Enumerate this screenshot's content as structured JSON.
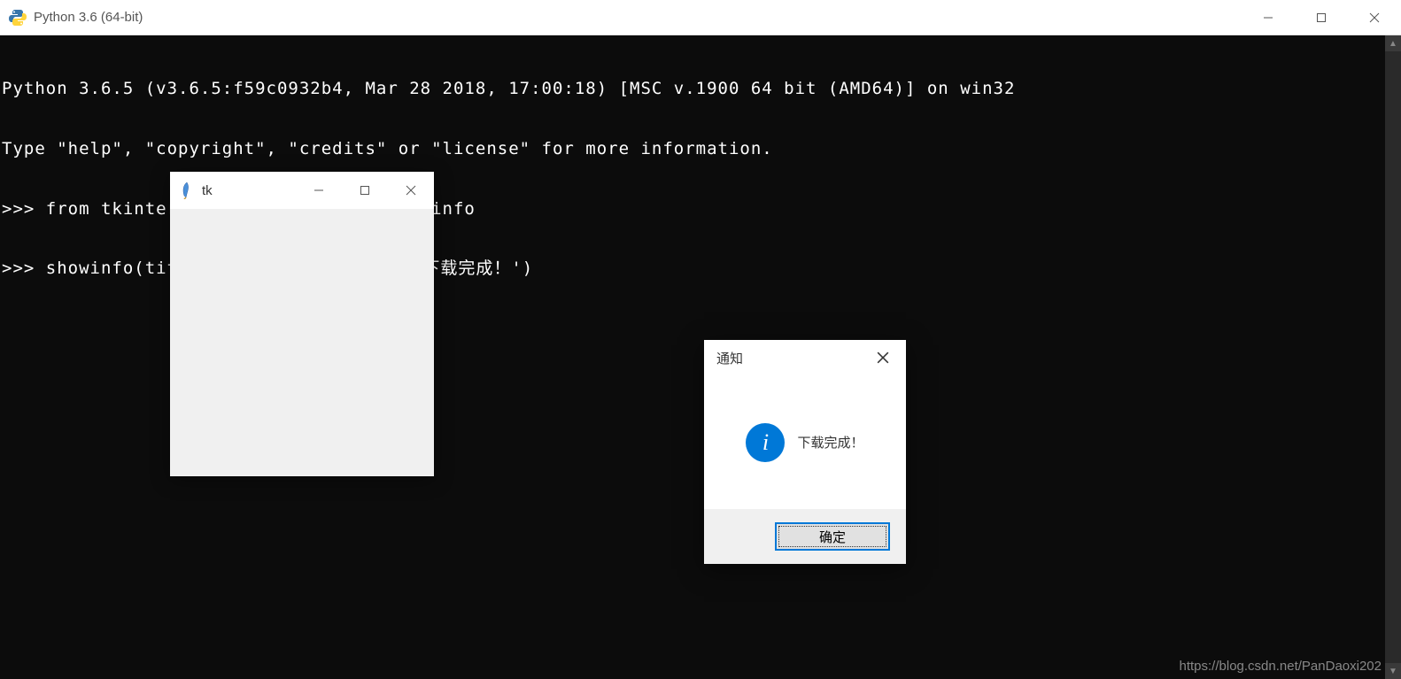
{
  "main_window": {
    "title": "Python 3.6 (64-bit)",
    "icon_name": "python-icon"
  },
  "console": {
    "line1": "Python 3.6.5 (v3.6.5:f59c0932b4, Mar 28 2018, 17:00:18) [MSC v.1900 64 bit (AMD64)] on win32",
    "line2": "Type \"help\", \"copyright\", \"credits\" or \"license\" for more information.",
    "line3": ">>> from tkinter.messagebox import showinfo",
    "line4": ">>> showinfo(title = '通知',message = '下载完成！')"
  },
  "tk_window": {
    "title": "tk",
    "icon_name": "feather-icon"
  },
  "msgbox": {
    "title": "通知",
    "message": "下载完成！",
    "ok_label": "确定",
    "icon_name": "info-icon"
  },
  "watermark": "https://blog.csdn.net/PanDaoxi202"
}
